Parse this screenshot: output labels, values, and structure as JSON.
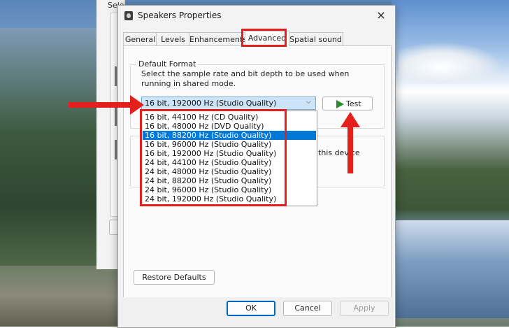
{
  "background_window": {
    "text": "Select a playback device below to modify its settings:"
  },
  "dialog": {
    "title": "Speakers Properties",
    "close_icon": "×"
  },
  "tabs": [
    {
      "label": "General"
    },
    {
      "label": "Levels"
    },
    {
      "label": "Enhancements"
    },
    {
      "label": "Advanced"
    },
    {
      "label": "Spatial sound"
    }
  ],
  "active_tab": "Advanced",
  "default_format": {
    "group_label": "Default Format",
    "description": "Select the sample rate and bit depth to be used when running in shared mode.",
    "selected_value": "16 bit, 192000 Hz (Studio Quality)",
    "test_button": "Test",
    "options": [
      "16 bit, 44100 Hz (CD Quality)",
      "16 bit, 48000 Hz (DVD Quality)",
      "16 bit, 88200 Hz (Studio Quality)",
      "16 bit, 96000 Hz (Studio Quality)",
      "16 bit, 192000 Hz (Studio Quality)",
      "24 bit, 44100 Hz (Studio Quality)",
      "24 bit, 48000 Hz (Studio Quality)",
      "24 bit, 88200 Hz (Studio Quality)",
      "24 bit, 96000 Hz (Studio Quality)",
      "24 bit, 192000 Hz (Studio Quality)"
    ],
    "highlighted_option": "16 bit, 88200 Hz (Studio Quality)"
  },
  "exclusive_mode": {
    "partial_text": "this device"
  },
  "buttons": {
    "restore_defaults": "Restore Defaults",
    "ok": "OK",
    "cancel": "Cancel",
    "apply": "Apply"
  },
  "colors": {
    "annotation_red": "#e3201b",
    "selection_blue": "#0078d7",
    "test_play_green": "#2d8b2d"
  }
}
